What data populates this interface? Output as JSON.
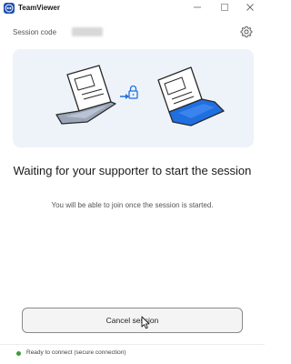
{
  "window": {
    "title": "TeamViewer",
    "minimize_icon": "minimize-icon",
    "maximize_icon": "maximize-icon",
    "close_icon": "close-icon"
  },
  "session": {
    "label": "Session code",
    "code_obscured": true,
    "settings_icon": "gear-icon"
  },
  "illustration": {
    "left_device": "laptop-icon",
    "connector": "lock-icon",
    "right_device": "laptop-icon",
    "accent_color": "#1f6fe0"
  },
  "main": {
    "heading": "Waiting for your supporter to start the session",
    "subtext": "You will be able to join once the session is started."
  },
  "actions": {
    "cancel_label": "Cancel session"
  },
  "status": {
    "text": "Ready to connect (secure connection)",
    "color": "#3b9a3b"
  }
}
